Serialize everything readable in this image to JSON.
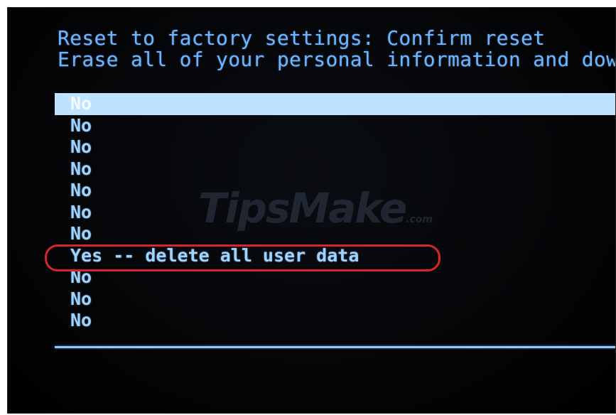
{
  "header": {
    "line1": "Reset to factory settings: Confirm reset",
    "line2": "Erase all of your personal information and dow"
  },
  "menu": {
    "items": [
      {
        "label": "No",
        "selected": true
      },
      {
        "label": "No",
        "selected": false
      },
      {
        "label": "No",
        "selected": false
      },
      {
        "label": "No",
        "selected": false
      },
      {
        "label": "No",
        "selected": false
      },
      {
        "label": "No",
        "selected": false
      },
      {
        "label": "No",
        "selected": false
      },
      {
        "label": "Yes -- delete all user data",
        "selected": false
      },
      {
        "label": "No",
        "selected": false
      },
      {
        "label": "No",
        "selected": false
      },
      {
        "label": "No",
        "selected": false
      }
    ]
  },
  "watermark": {
    "text": "TipsMake",
    "suffix": ".com"
  },
  "colors": {
    "text_blue": "#6fb4ff",
    "menu_text": "#9ed2ff",
    "selection_bar": "#bfe3ff",
    "highlight_ring": "#d6262b",
    "background": "#000000"
  }
}
